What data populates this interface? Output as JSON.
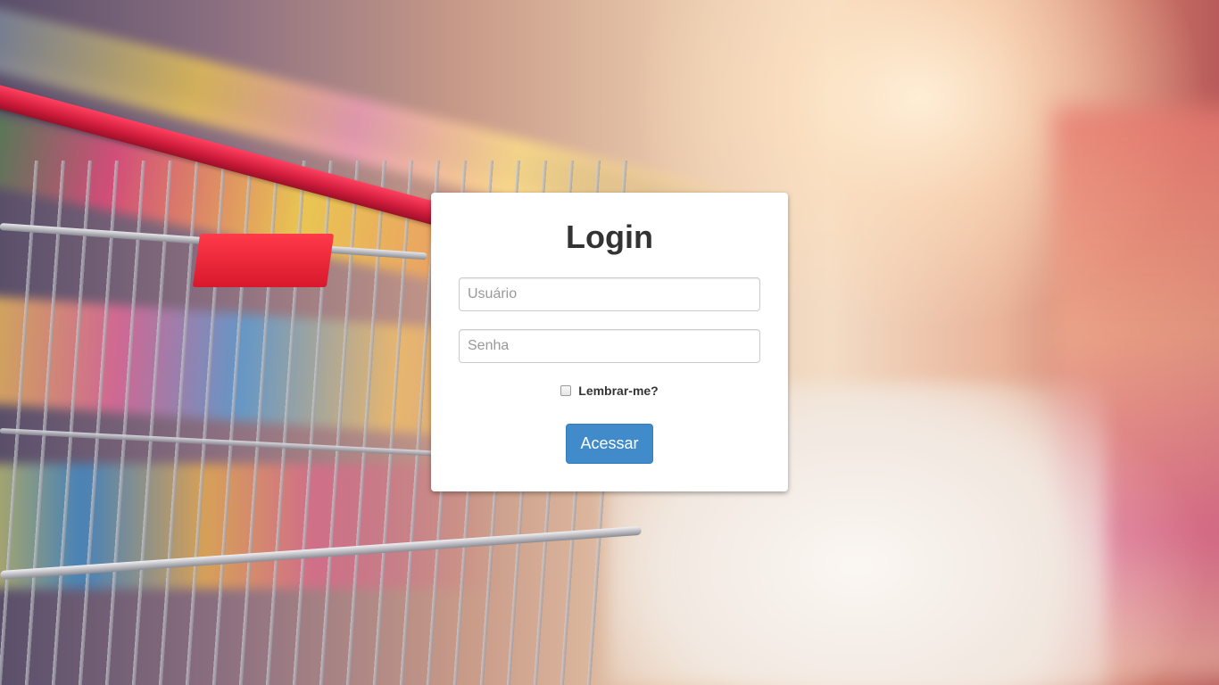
{
  "login": {
    "title": "Login",
    "username_placeholder": "Usuário",
    "password_placeholder": "Senha",
    "remember_label": "Lembrar-me?",
    "submit_label": "Acessar"
  },
  "colors": {
    "primary_button": "#428bca",
    "card_background": "#ffffff",
    "title_text": "#333333"
  }
}
